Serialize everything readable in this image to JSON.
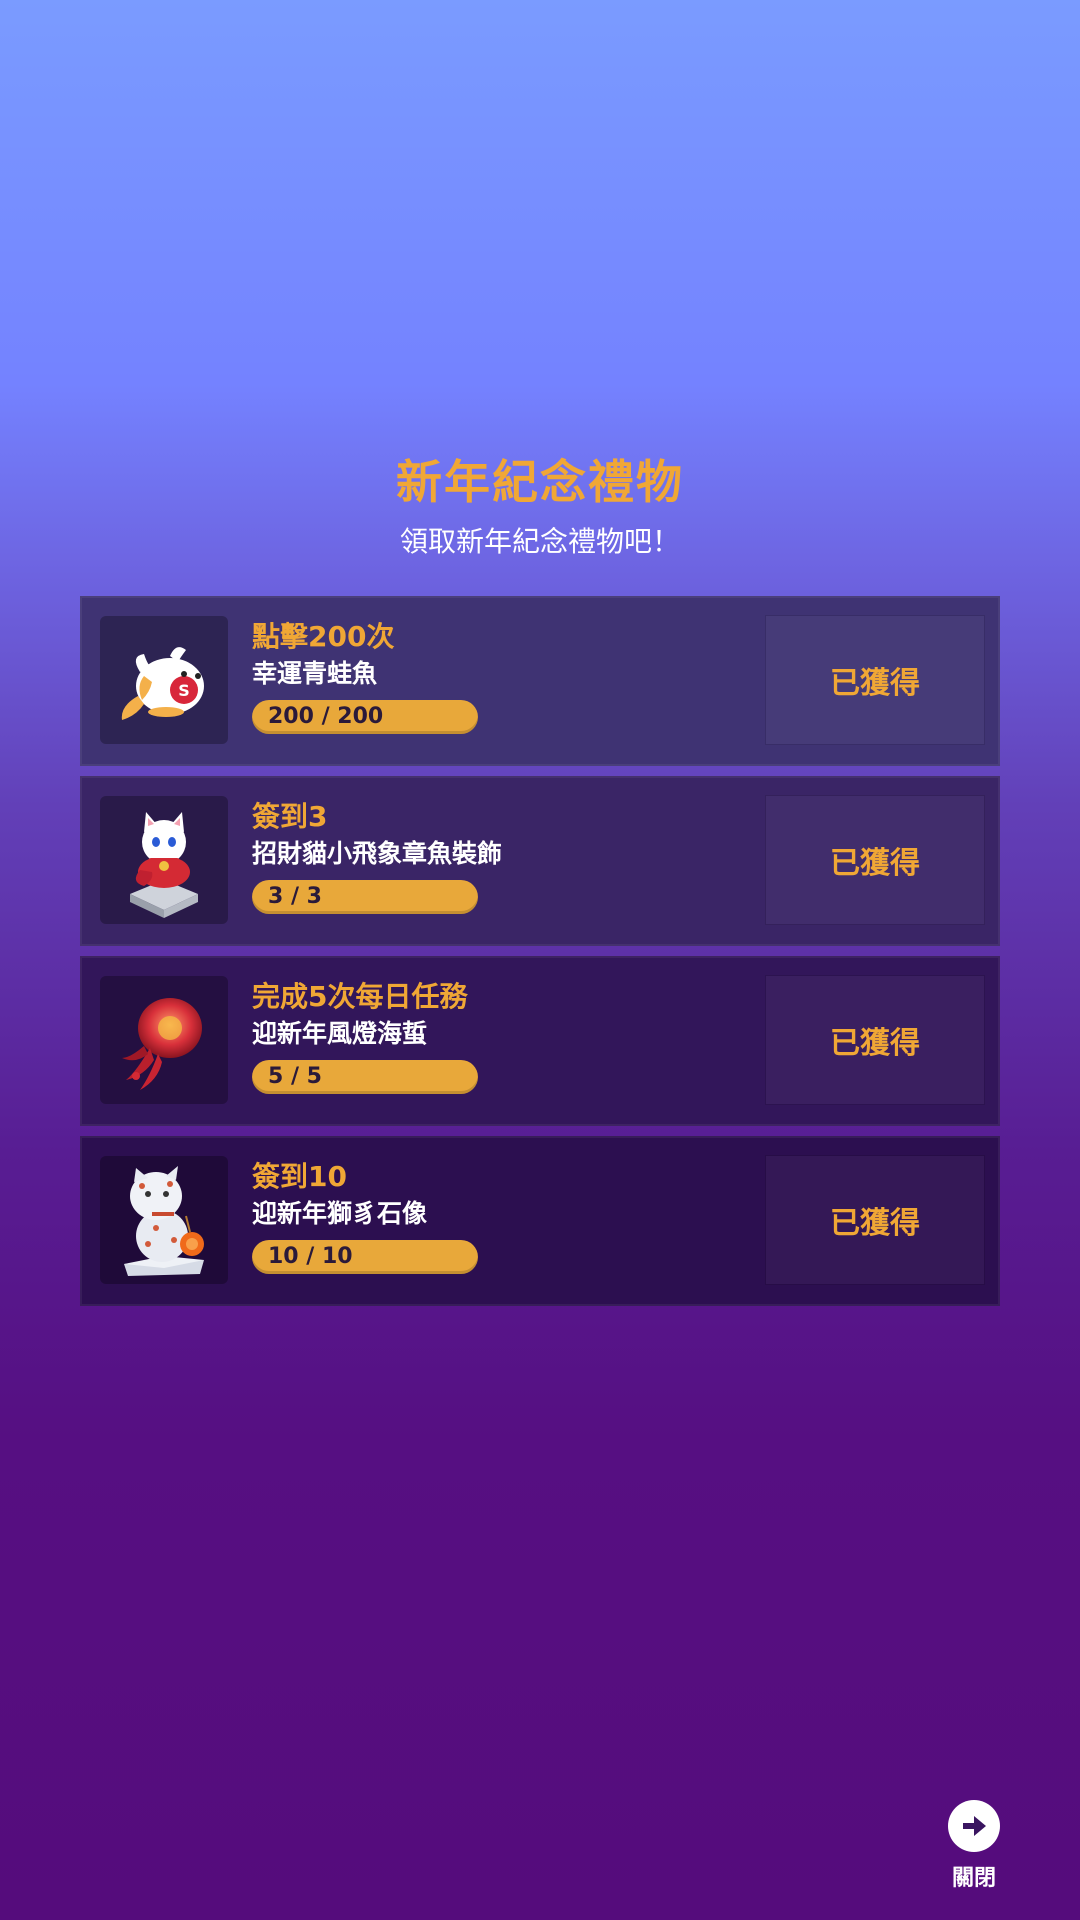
{
  "header": {
    "title": "新年紀念禮物",
    "subtitle": "領取新年紀念禮物吧！"
  },
  "items": [
    {
      "task": "點擊200次",
      "reward": "幸運青蛙魚",
      "progress_text": "200 / 200",
      "progress_current": 200,
      "progress_total": 200,
      "status": "已獲得",
      "icon": "lucky-frog-fish-icon"
    },
    {
      "task": "簽到3",
      "reward": "招財貓小飛象章魚裝飾",
      "progress_text": "3 / 3",
      "progress_current": 3,
      "progress_total": 3,
      "status": "已獲得",
      "icon": "lucky-cat-icon"
    },
    {
      "task": "完成5次每日任務",
      "reward": "迎新年風燈海蜇",
      "progress_text": "5 / 5",
      "progress_current": 5,
      "progress_total": 5,
      "status": "已獲得",
      "icon": "lantern-jellyfish-icon"
    },
    {
      "task": "簽到10",
      "reward": "迎新年獅豸石像",
      "progress_text": "10 / 10",
      "progress_current": 10,
      "progress_total": 10,
      "status": "已獲得",
      "icon": "lion-statue-icon"
    }
  ],
  "close": {
    "label": "關閉",
    "icon": "arrow-right-icon"
  },
  "colors": {
    "accent": "#f0a735",
    "progress": "#e8a83a",
    "text": "#ffffff"
  }
}
